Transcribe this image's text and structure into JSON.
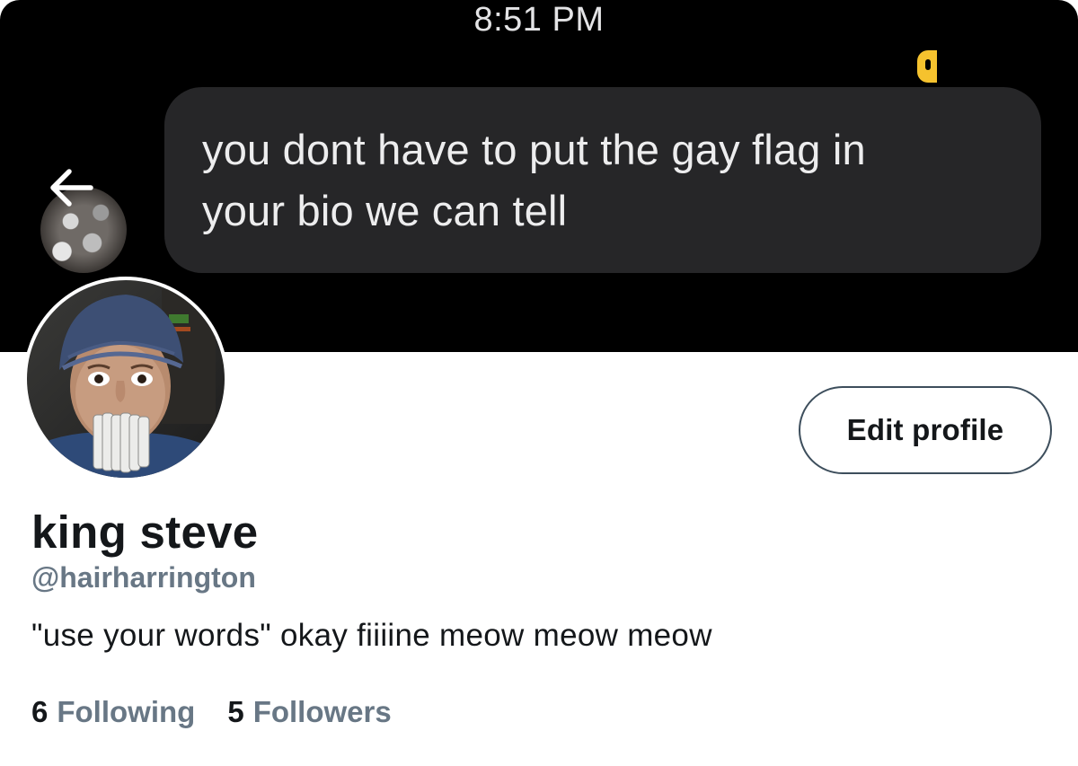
{
  "banner": {
    "time": "8:51 PM",
    "message": "you dont have to put the gay flag in\nyour bio we can tell",
    "accent_color": "#f5c22e"
  },
  "icons": {
    "back": "back-arrow-icon"
  },
  "profile": {
    "display_name": "king steve",
    "handle": "@hairharrington",
    "bio": "\"use your words\" okay fiiiine meow meow meow",
    "edit_button_label": "Edit profile",
    "following_count": "6",
    "following_label": "Following",
    "followers_count": "5",
    "followers_label": "Followers"
  },
  "colors": {
    "banner_background": "#000000",
    "bubble_background": "#262628",
    "secondary_text": "#687785",
    "primary_text": "#14171a"
  }
}
